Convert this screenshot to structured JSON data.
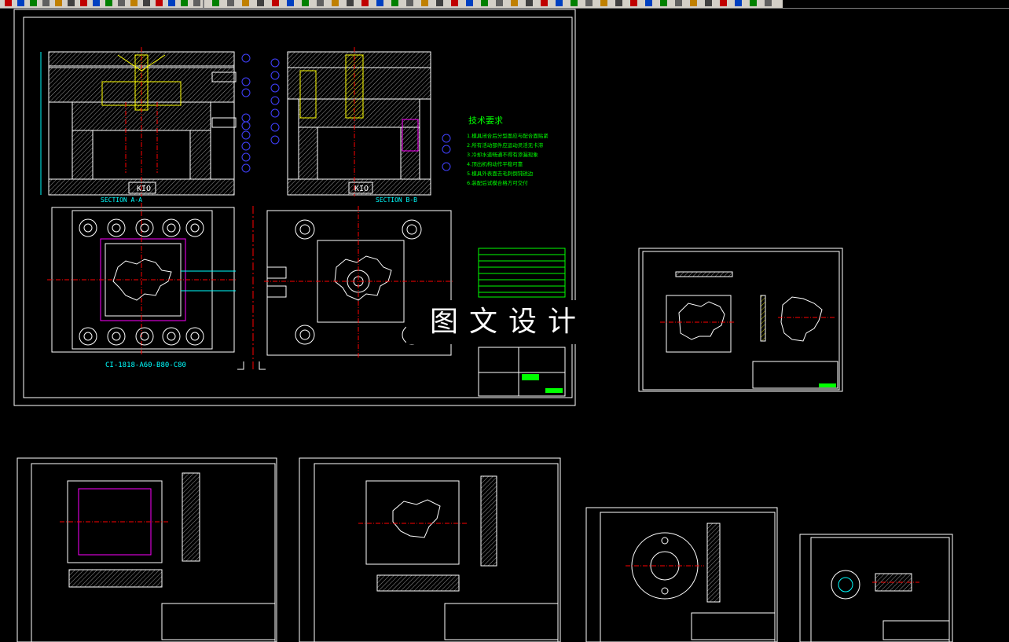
{
  "toolbar": {
    "buttons": [
      "new",
      "open",
      "save",
      "print",
      "preview",
      "cut",
      "copy",
      "paste",
      "undo",
      "redo",
      "pan",
      "zoom",
      "properties",
      "layers",
      "linetype",
      "color"
    ]
  },
  "drawing": {
    "background": "#000000",
    "colors": {
      "frame": "#ffffff",
      "part": "#ffffff",
      "centerline": "#ff0000",
      "dimension": "#00ffff",
      "note": "#00ff00",
      "hatch": "#ffff00",
      "cavity": "#ff00ff",
      "balloon": "#4040ff"
    },
    "section_aa": "SECTION A-A",
    "section_bb": "SECTION B-B",
    "model_code": "CI-1818-A60-B80-C80",
    "kio_left": "KIO",
    "kio_right": "KIO",
    "tech_req_title": "技术要求",
    "tech_req_lines": [
      "1.模具闭合后分型面应与配合面贴紧",
      "2.所有活动部件应运动灵活无卡滞",
      "3.冷却水道畅通不得有渗漏现象",
      "4.顶出机构动作平稳可靠",
      "5.模具外表面去毛刺倒钝锐边",
      "6.装配后试模合格方可交付"
    ],
    "watermark": "图文设计"
  }
}
